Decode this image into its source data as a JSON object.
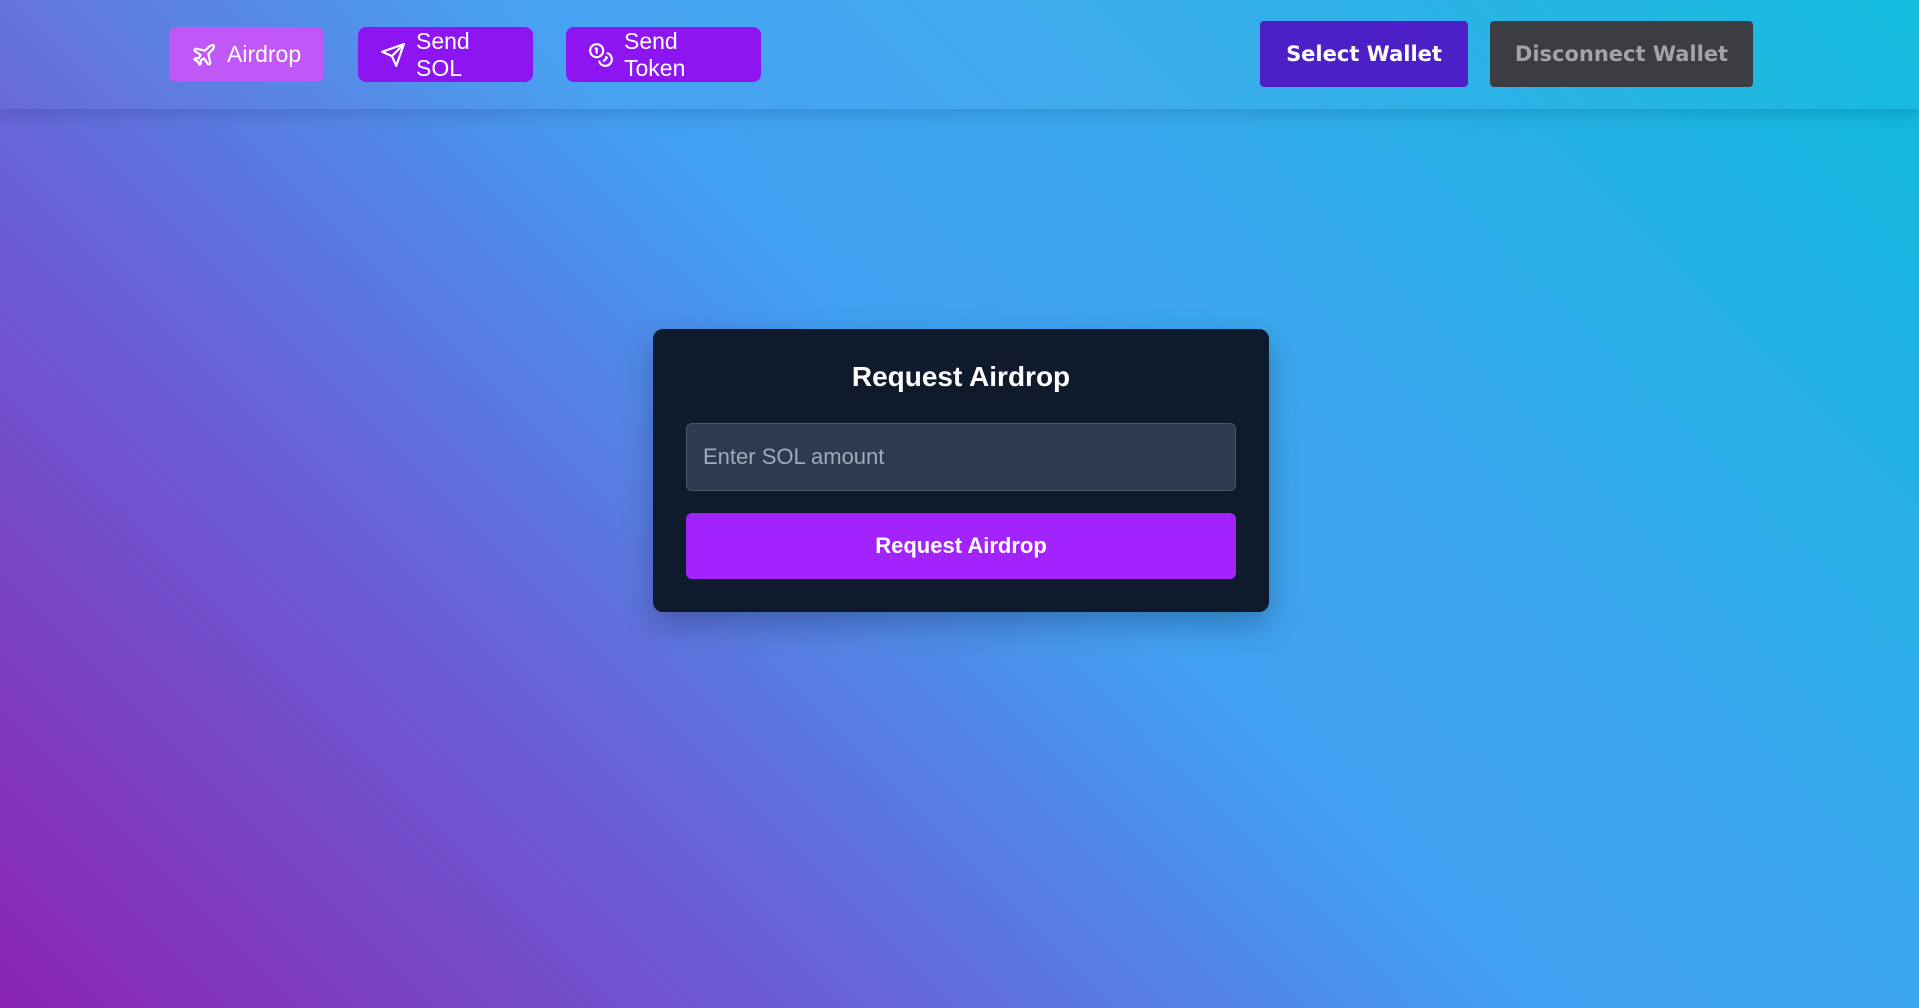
{
  "navbar": {
    "tabs": [
      {
        "label": "Airdrop",
        "icon": "plane-icon",
        "active": true
      },
      {
        "label": "Send SOL",
        "icon": "send-icon",
        "active": false
      },
      {
        "label": "Send Token",
        "icon": "coins-icon",
        "active": false
      }
    ],
    "select_wallet_label": "Select Wallet",
    "disconnect_wallet_label": "Disconnect Wallet"
  },
  "card": {
    "title": "Request Airdrop",
    "amount_input": {
      "value": "",
      "placeholder": "Enter SOL amount"
    },
    "submit_label": "Request Airdrop"
  },
  "colors": {
    "active_tab": "#c157f6",
    "tab": "#8c15f2",
    "select_wallet": "#4d1fc6",
    "disconnect_wallet": "#3b3d43",
    "card_background": "#0f1a2d",
    "input_background": "#2e3a51",
    "primary_button": "#a323fc"
  }
}
